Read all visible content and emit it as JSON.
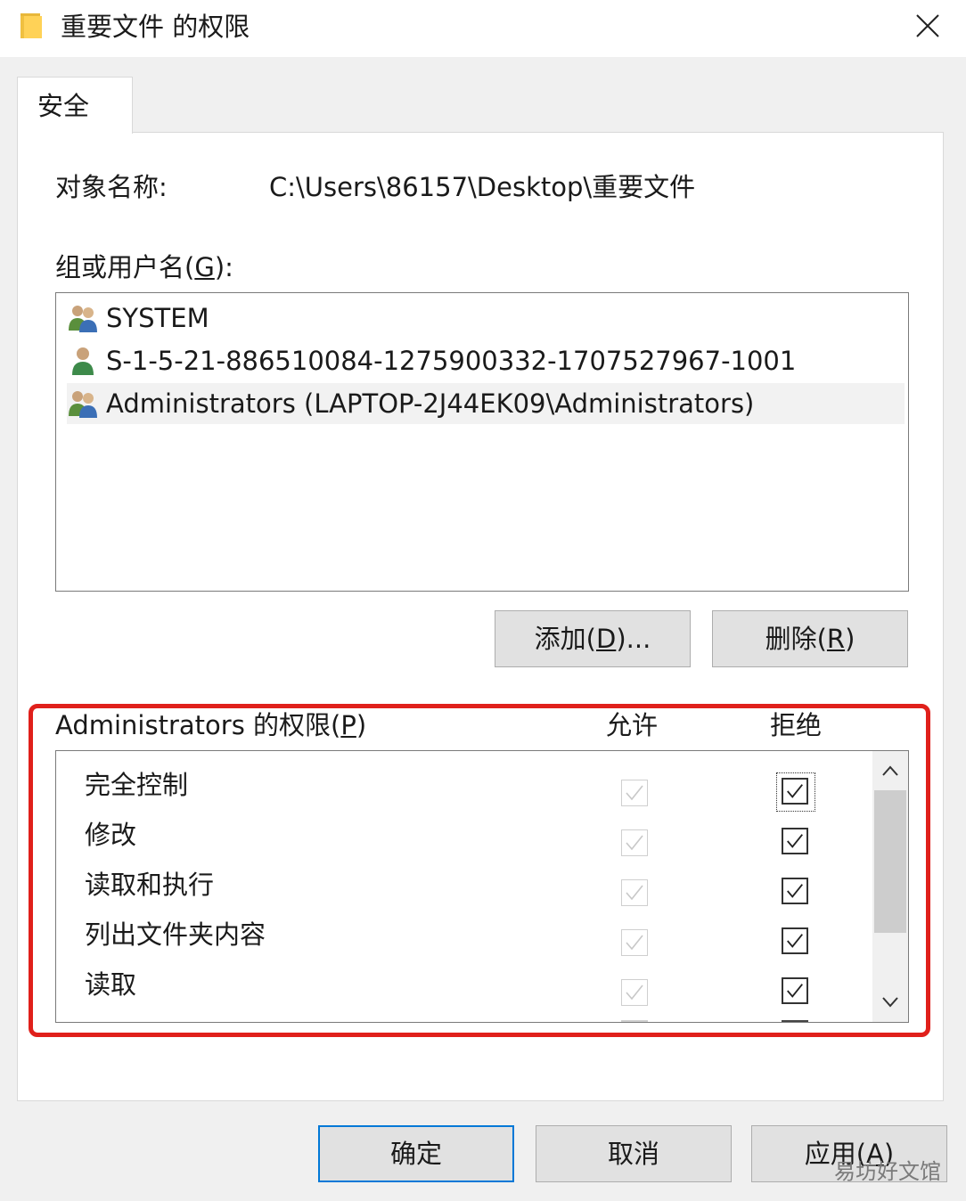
{
  "window": {
    "title": "重要文件 的权限"
  },
  "tabs": [
    {
      "label": "安全"
    }
  ],
  "object": {
    "label": "对象名称:",
    "value": "C:\\Users\\86157\\Desktop\\重要文件"
  },
  "users": {
    "label_prefix": "组或用户名(",
    "label_key": "G",
    "label_suffix": "):",
    "items": [
      {
        "name": "SYSTEM",
        "icon": "group-users-icon"
      },
      {
        "name": "S-1-5-21-886510084-1275900332-1707527967-1001",
        "icon": "single-user-icon"
      },
      {
        "name": "Administrators (LAPTOP-2J44EK09\\Administrators)",
        "icon": "group-users-icon",
        "selected": true
      }
    ],
    "add_prefix": "添加(",
    "add_key": "D",
    "add_suffix": ")...",
    "remove_prefix": "删除(",
    "remove_key": "R",
    "remove_suffix": ")"
  },
  "permissions": {
    "label_prefix": "Administrators 的权限(",
    "label_key": "P",
    "label_suffix": ")",
    "allow_header": "允许",
    "deny_header": "拒绝",
    "rows": [
      {
        "name": "完全控制",
        "allow": true,
        "deny": true
      },
      {
        "name": "修改",
        "allow": true,
        "deny": true
      },
      {
        "name": "读取和执行",
        "allow": true,
        "deny": true
      },
      {
        "name": "列出文件夹内容",
        "allow": true,
        "deny": true
      },
      {
        "name": "读取",
        "allow": true,
        "deny": true
      }
    ]
  },
  "footer": {
    "ok": "确定",
    "cancel": "取消",
    "apply_prefix": "应用(",
    "apply_key": "A",
    "apply_suffix": ")"
  },
  "watermark": "易坊好文馆",
  "colors": {
    "highlight_box": "#e0201b",
    "default_button_border": "#0078d7",
    "button_face": "#e1e1e1",
    "dialog_bg": "#f0f0f0"
  }
}
